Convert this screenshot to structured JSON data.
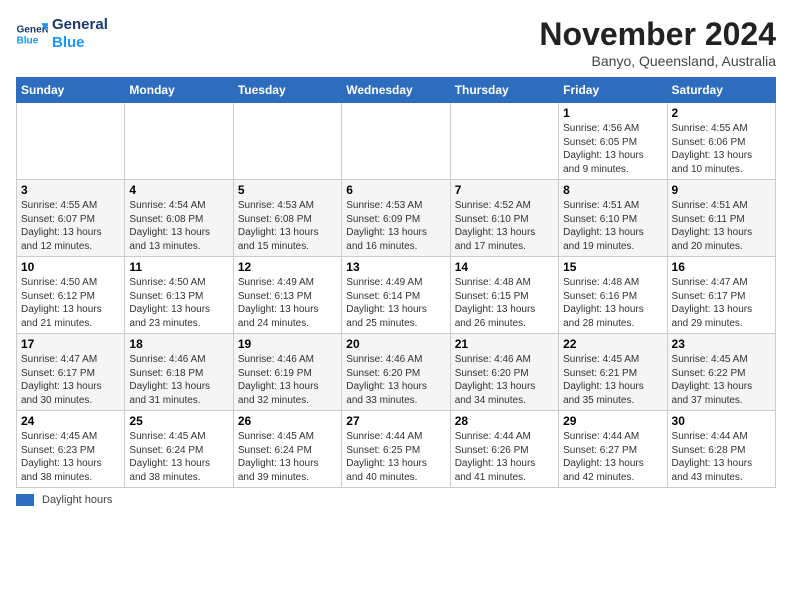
{
  "logo": {
    "line1": "General",
    "line2": "Blue"
  },
  "title": "November 2024",
  "location": "Banyo, Queensland, Australia",
  "days_of_week": [
    "Sunday",
    "Monday",
    "Tuesday",
    "Wednesday",
    "Thursday",
    "Friday",
    "Saturday"
  ],
  "legend_label": "Daylight hours",
  "weeks": [
    [
      {
        "day": "",
        "info": ""
      },
      {
        "day": "",
        "info": ""
      },
      {
        "day": "",
        "info": ""
      },
      {
        "day": "",
        "info": ""
      },
      {
        "day": "",
        "info": ""
      },
      {
        "day": "1",
        "info": "Sunrise: 4:56 AM\nSunset: 6:05 PM\nDaylight: 13 hours and 9 minutes."
      },
      {
        "day": "2",
        "info": "Sunrise: 4:55 AM\nSunset: 6:06 PM\nDaylight: 13 hours and 10 minutes."
      }
    ],
    [
      {
        "day": "3",
        "info": "Sunrise: 4:55 AM\nSunset: 6:07 PM\nDaylight: 13 hours and 12 minutes."
      },
      {
        "day": "4",
        "info": "Sunrise: 4:54 AM\nSunset: 6:08 PM\nDaylight: 13 hours and 13 minutes."
      },
      {
        "day": "5",
        "info": "Sunrise: 4:53 AM\nSunset: 6:08 PM\nDaylight: 13 hours and 15 minutes."
      },
      {
        "day": "6",
        "info": "Sunrise: 4:53 AM\nSunset: 6:09 PM\nDaylight: 13 hours and 16 minutes."
      },
      {
        "day": "7",
        "info": "Sunrise: 4:52 AM\nSunset: 6:10 PM\nDaylight: 13 hours and 17 minutes."
      },
      {
        "day": "8",
        "info": "Sunrise: 4:51 AM\nSunset: 6:10 PM\nDaylight: 13 hours and 19 minutes."
      },
      {
        "day": "9",
        "info": "Sunrise: 4:51 AM\nSunset: 6:11 PM\nDaylight: 13 hours and 20 minutes."
      }
    ],
    [
      {
        "day": "10",
        "info": "Sunrise: 4:50 AM\nSunset: 6:12 PM\nDaylight: 13 hours and 21 minutes."
      },
      {
        "day": "11",
        "info": "Sunrise: 4:50 AM\nSunset: 6:13 PM\nDaylight: 13 hours and 23 minutes."
      },
      {
        "day": "12",
        "info": "Sunrise: 4:49 AM\nSunset: 6:13 PM\nDaylight: 13 hours and 24 minutes."
      },
      {
        "day": "13",
        "info": "Sunrise: 4:49 AM\nSunset: 6:14 PM\nDaylight: 13 hours and 25 minutes."
      },
      {
        "day": "14",
        "info": "Sunrise: 4:48 AM\nSunset: 6:15 PM\nDaylight: 13 hours and 26 minutes."
      },
      {
        "day": "15",
        "info": "Sunrise: 4:48 AM\nSunset: 6:16 PM\nDaylight: 13 hours and 28 minutes."
      },
      {
        "day": "16",
        "info": "Sunrise: 4:47 AM\nSunset: 6:17 PM\nDaylight: 13 hours and 29 minutes."
      }
    ],
    [
      {
        "day": "17",
        "info": "Sunrise: 4:47 AM\nSunset: 6:17 PM\nDaylight: 13 hours and 30 minutes."
      },
      {
        "day": "18",
        "info": "Sunrise: 4:46 AM\nSunset: 6:18 PM\nDaylight: 13 hours and 31 minutes."
      },
      {
        "day": "19",
        "info": "Sunrise: 4:46 AM\nSunset: 6:19 PM\nDaylight: 13 hours and 32 minutes."
      },
      {
        "day": "20",
        "info": "Sunrise: 4:46 AM\nSunset: 6:20 PM\nDaylight: 13 hours and 33 minutes."
      },
      {
        "day": "21",
        "info": "Sunrise: 4:46 AM\nSunset: 6:20 PM\nDaylight: 13 hours and 34 minutes."
      },
      {
        "day": "22",
        "info": "Sunrise: 4:45 AM\nSunset: 6:21 PM\nDaylight: 13 hours and 35 minutes."
      },
      {
        "day": "23",
        "info": "Sunrise: 4:45 AM\nSunset: 6:22 PM\nDaylight: 13 hours and 37 minutes."
      }
    ],
    [
      {
        "day": "24",
        "info": "Sunrise: 4:45 AM\nSunset: 6:23 PM\nDaylight: 13 hours and 38 minutes."
      },
      {
        "day": "25",
        "info": "Sunrise: 4:45 AM\nSunset: 6:24 PM\nDaylight: 13 hours and 38 minutes."
      },
      {
        "day": "26",
        "info": "Sunrise: 4:45 AM\nSunset: 6:24 PM\nDaylight: 13 hours and 39 minutes."
      },
      {
        "day": "27",
        "info": "Sunrise: 4:44 AM\nSunset: 6:25 PM\nDaylight: 13 hours and 40 minutes."
      },
      {
        "day": "28",
        "info": "Sunrise: 4:44 AM\nSunset: 6:26 PM\nDaylight: 13 hours and 41 minutes."
      },
      {
        "day": "29",
        "info": "Sunrise: 4:44 AM\nSunset: 6:27 PM\nDaylight: 13 hours and 42 minutes."
      },
      {
        "day": "30",
        "info": "Sunrise: 4:44 AM\nSunset: 6:28 PM\nDaylight: 13 hours and 43 minutes."
      }
    ]
  ]
}
